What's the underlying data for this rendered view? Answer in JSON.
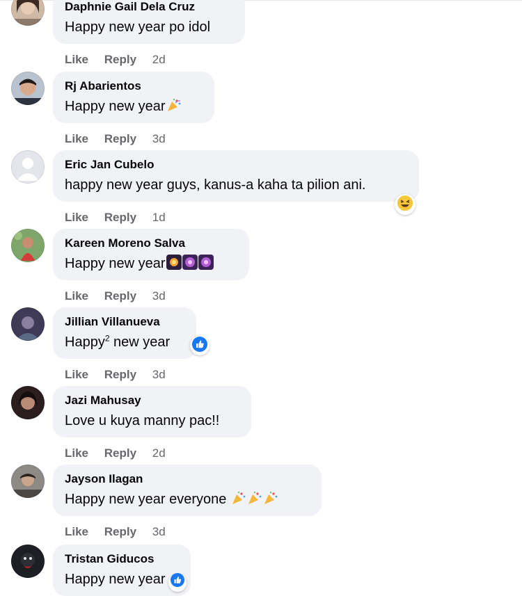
{
  "actions": {
    "like_label": "Like",
    "reply_label": "Reply"
  },
  "colors": {
    "bubble_bg": "#f0f2f5",
    "meta_gray": "#65676b",
    "like_blue": "#1877f2",
    "haha_yellow": "#f7c73b"
  },
  "comments": [
    {
      "author": "Daphnie Gail Dela Cruz",
      "text": "Happy new year po idol",
      "time": "2d"
    },
    {
      "author": "Rj Abarientos",
      "text": "Happy new year",
      "time": "3d",
      "emojis": [
        "party-popper"
      ]
    },
    {
      "author": "Eric Jan Cubelo",
      "text": "happy new year guys, kanus-a kaha ta pilion ani.",
      "time": "1d",
      "reaction": "haha-icon"
    },
    {
      "author": "Kareen Moreno Salva",
      "text": "Happy new year",
      "time": "3d",
      "emojis": [
        "fireworks",
        "sparkler",
        "sparkler"
      ]
    },
    {
      "author": "Jillian Villanueva",
      "text": "Happy",
      "superscript": "2",
      "text_after": " new year",
      "time": "3d",
      "reaction": "like-icon"
    },
    {
      "author": "Jazi Mahusay",
      "text": "Love u kuya manny pac!!",
      "time": "2d"
    },
    {
      "author": "Jayson Ilagan",
      "text": "Happy new year everyone",
      "time": "3d",
      "emojis": [
        "party-popper",
        "party-popper",
        "party-popper"
      ]
    },
    {
      "author": "Tristan Giducos",
      "text": "Happy new year",
      "reaction": "like-icon"
    }
  ]
}
